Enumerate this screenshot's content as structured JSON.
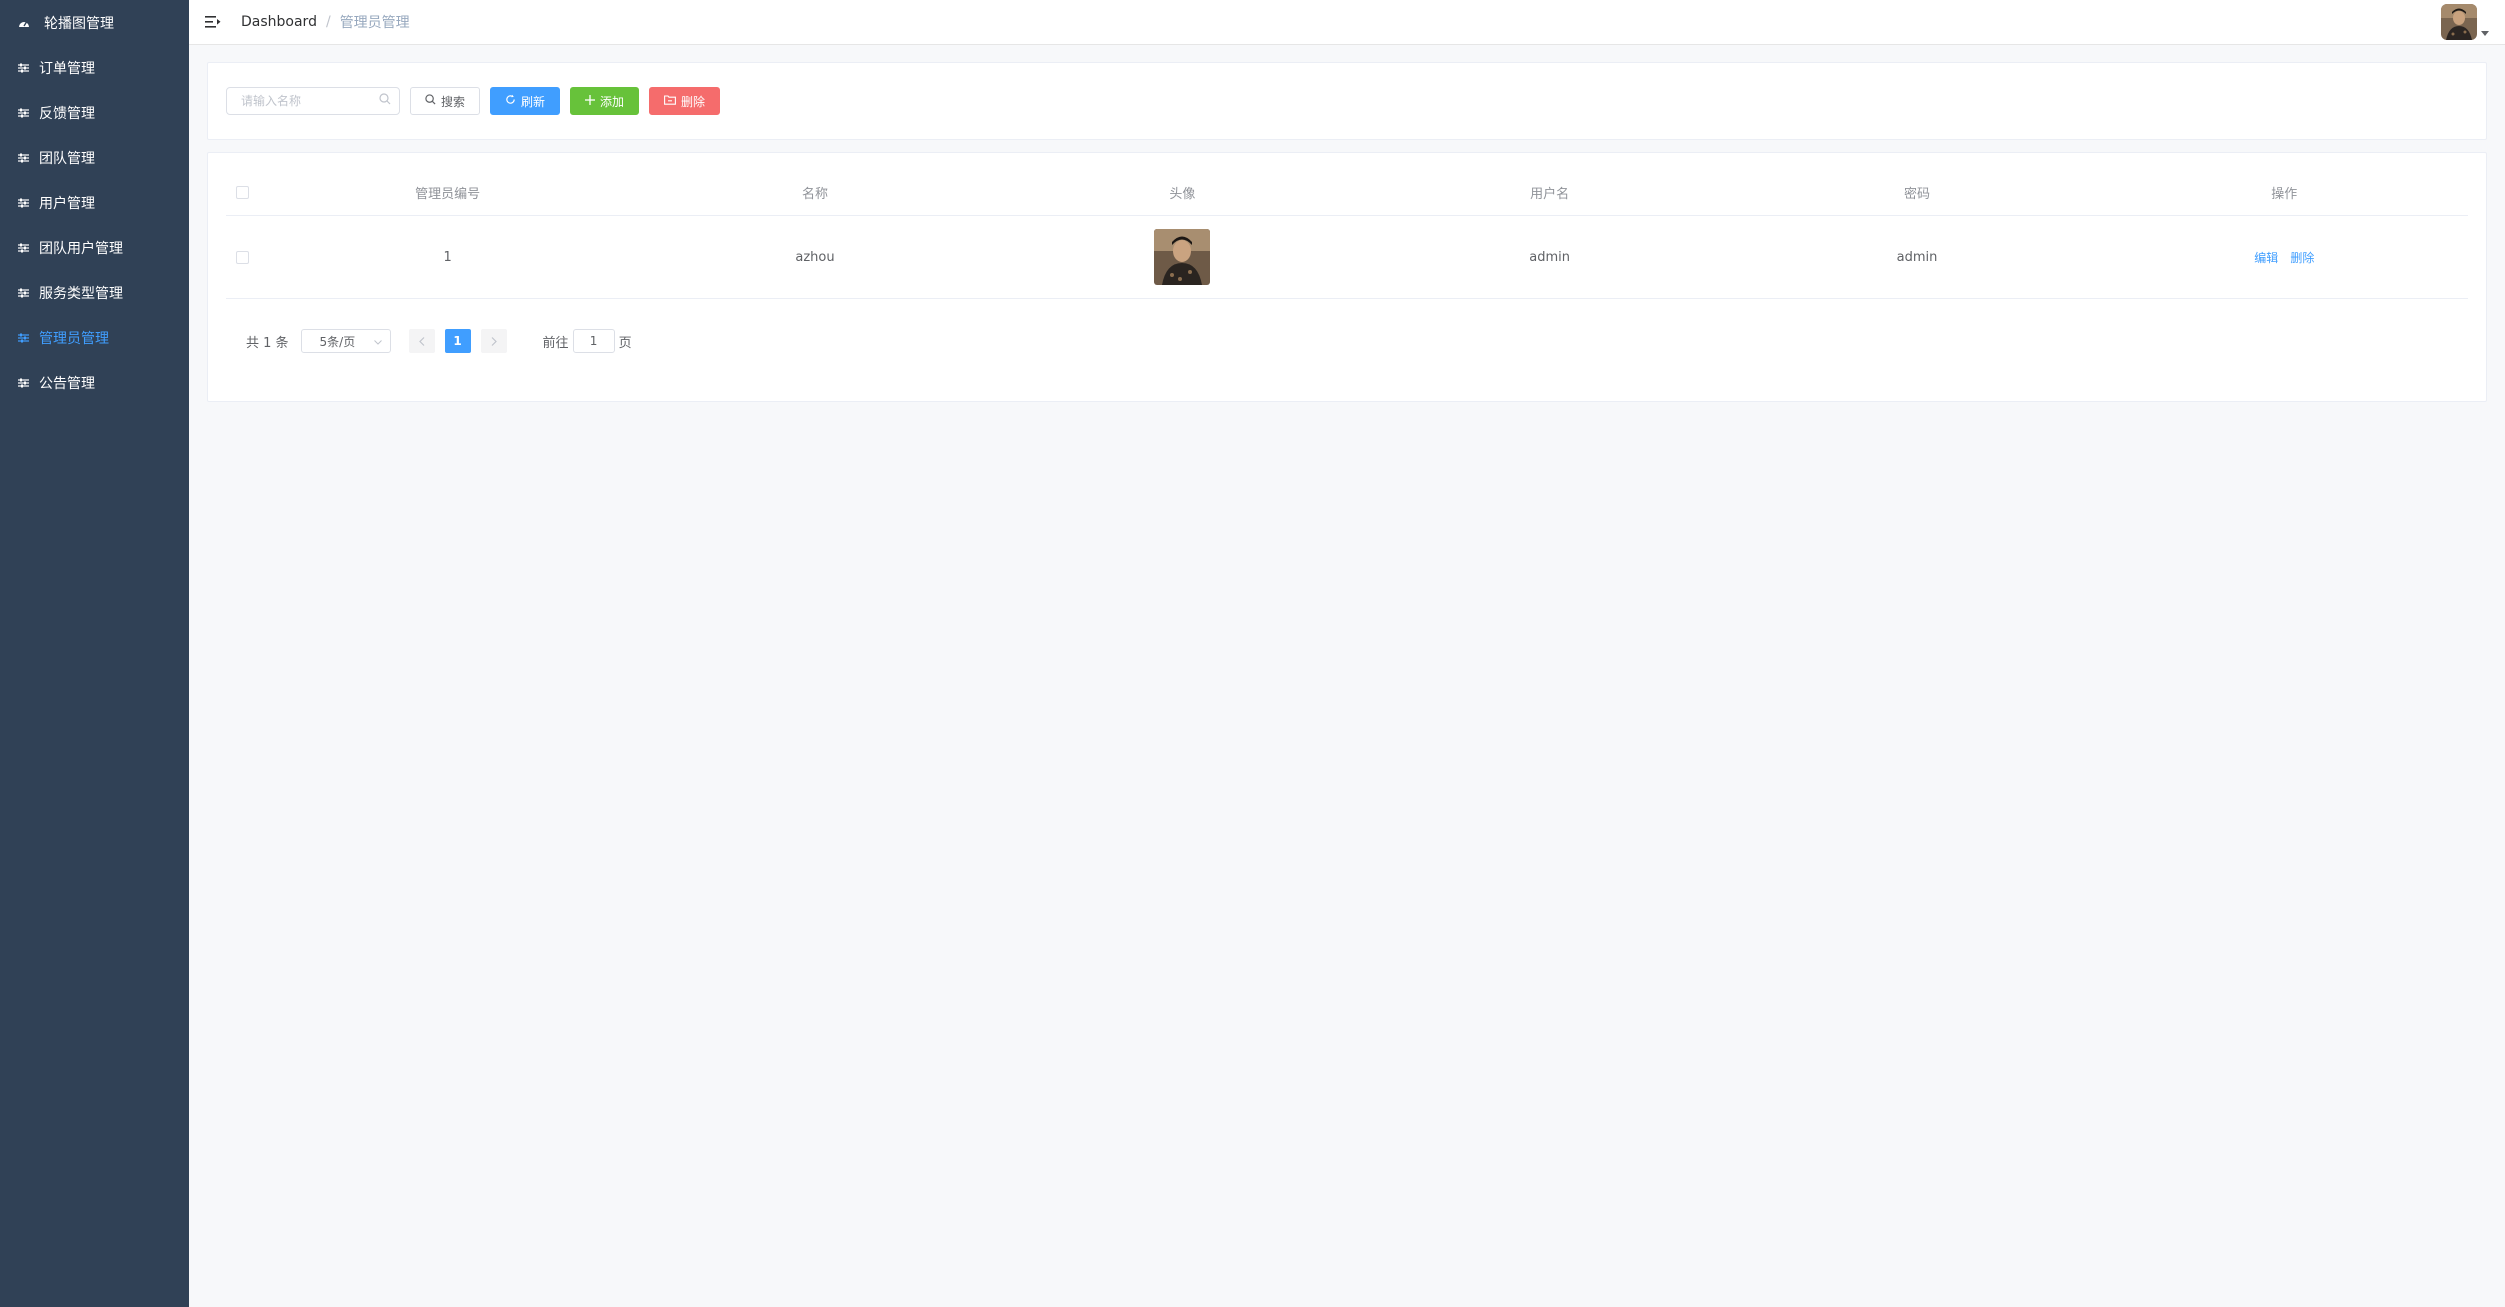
{
  "sidebar": {
    "items": [
      {
        "label": "轮播图管理",
        "icon": "dashboard-icon",
        "active": false
      },
      {
        "label": "订单管理",
        "icon": "sliders-icon",
        "active": false
      },
      {
        "label": "反馈管理",
        "icon": "sliders-icon",
        "active": false
      },
      {
        "label": "团队管理",
        "icon": "sliders-icon",
        "active": false
      },
      {
        "label": "用户管理",
        "icon": "sliders-icon",
        "active": false
      },
      {
        "label": "团队用户管理",
        "icon": "sliders-icon",
        "active": false
      },
      {
        "label": "服务类型管理",
        "icon": "sliders-icon",
        "active": false
      },
      {
        "label": "管理员管理",
        "icon": "sliders-icon",
        "active": true
      },
      {
        "label": "公告管理",
        "icon": "sliders-icon",
        "active": false
      }
    ],
    "bg_color": "#304156",
    "active_color": "#409eff"
  },
  "navbar": {
    "breadcrumb_home": "Dashboard",
    "breadcrumb_sep": "/",
    "breadcrumb_current": "管理员管理"
  },
  "toolbar": {
    "search_placeholder": "请输入名称",
    "search_label": "搜索",
    "refresh_label": "刷新",
    "add_label": "添加",
    "delete_label": "删除"
  },
  "table": {
    "columns": [
      "管理员编号",
      "名称",
      "头像",
      "用户名",
      "密码",
      "操作"
    ],
    "rows": [
      {
        "id": "1",
        "name": "azhou",
        "username": "admin",
        "password": "admin",
        "edit": "编辑",
        "delete": "删除"
      }
    ]
  },
  "pagination": {
    "total": "共 1 条",
    "page_size": "5条/页",
    "current": "1",
    "goto_prefix": "前往",
    "goto_value": "1",
    "goto_suffix": "页"
  },
  "colors": {
    "primary": "#409eff",
    "success": "#67c23a",
    "danger": "#f56c6c"
  }
}
